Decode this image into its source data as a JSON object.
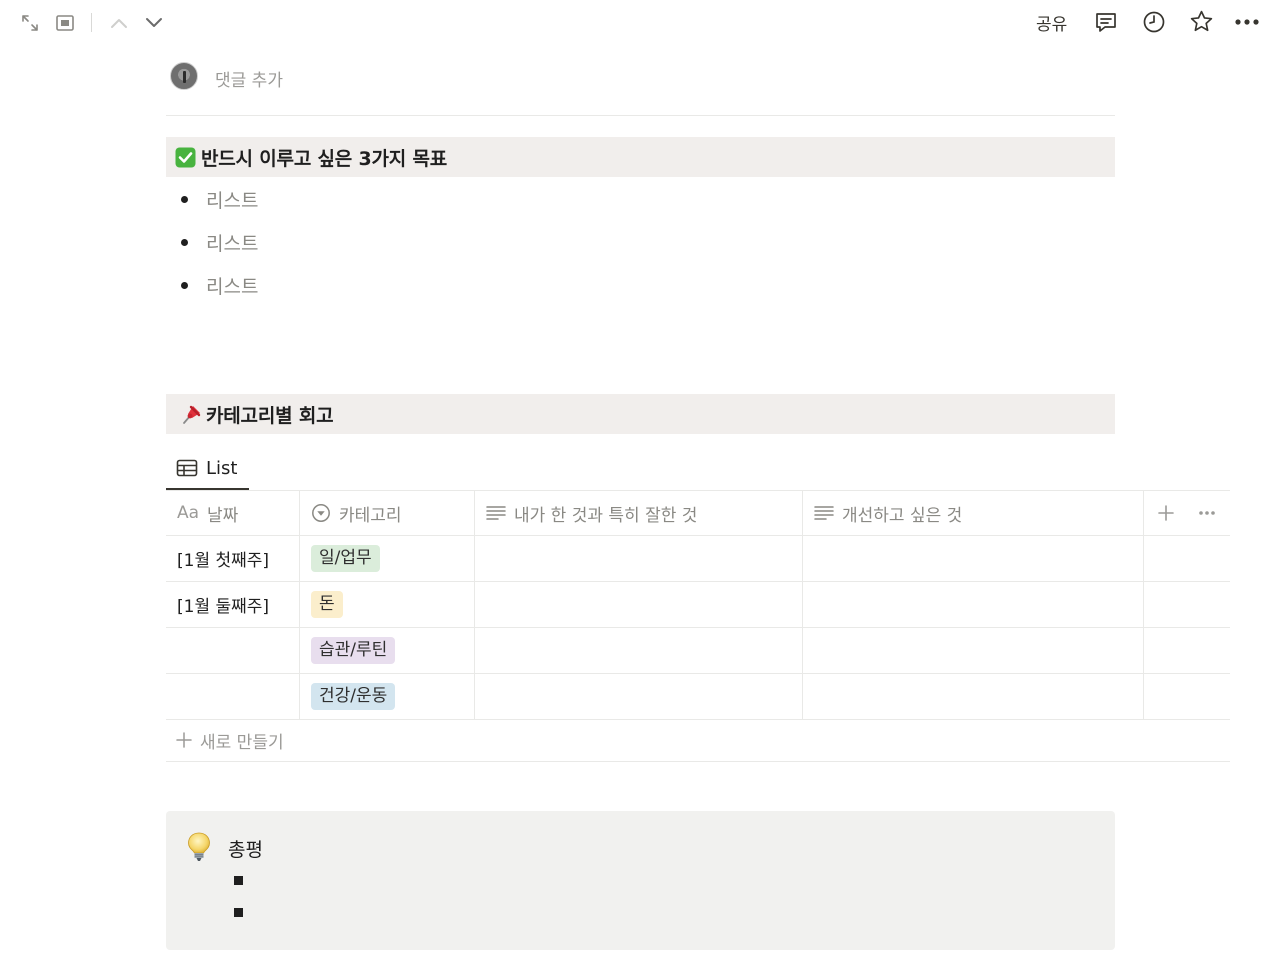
{
  "topbar": {
    "share_label": "공유",
    "icons": [
      "expand-icon",
      "peek-icon",
      "chevron-up-icon",
      "chevron-down-icon",
      "comment-icon",
      "clock-icon",
      "star-icon",
      "more-icon"
    ]
  },
  "comment": {
    "placeholder": "댓글 추가"
  },
  "goals_section": {
    "emoji": "check-box-icon",
    "title": "반드시 이루고 싶은 3가지 목표",
    "items": [
      "리스트",
      "리스트",
      "리스트"
    ]
  },
  "retro_section": {
    "emoji": "pushpin-icon",
    "title": "카테고리별 회고"
  },
  "database": {
    "view_tab_label": "List",
    "columns": [
      {
        "icon": "text-aa-icon",
        "icon_text": "Aa",
        "label": "날짜"
      },
      {
        "icon": "select-icon",
        "label": "카테고리"
      },
      {
        "icon": "text-lines-icon",
        "label": "내가 한 것과 특히 잘한 것"
      },
      {
        "icon": "text-lines-icon",
        "label": "개선하고 싶은 것"
      }
    ],
    "rows": [
      {
        "date": "[1월 첫째주]",
        "category": "일/업무",
        "category_color": "#dbeddb",
        "did_well": "",
        "improve": ""
      },
      {
        "date": "[1월 둘째주]",
        "category": "돈",
        "category_color": "#fbeecc",
        "did_well": "",
        "improve": ""
      },
      {
        "date": "",
        "category": "습관/루틴",
        "category_color": "#e8deee",
        "did_well": "",
        "improve": ""
      },
      {
        "date": "",
        "category": "건강/운동",
        "category_color": "#d3e5ef",
        "did_well": "",
        "improve": ""
      }
    ],
    "new_row_label": "새로 만들기"
  },
  "callout": {
    "emoji": "lightbulb-icon",
    "title": "총평",
    "bullets": [
      "",
      ""
    ]
  }
}
